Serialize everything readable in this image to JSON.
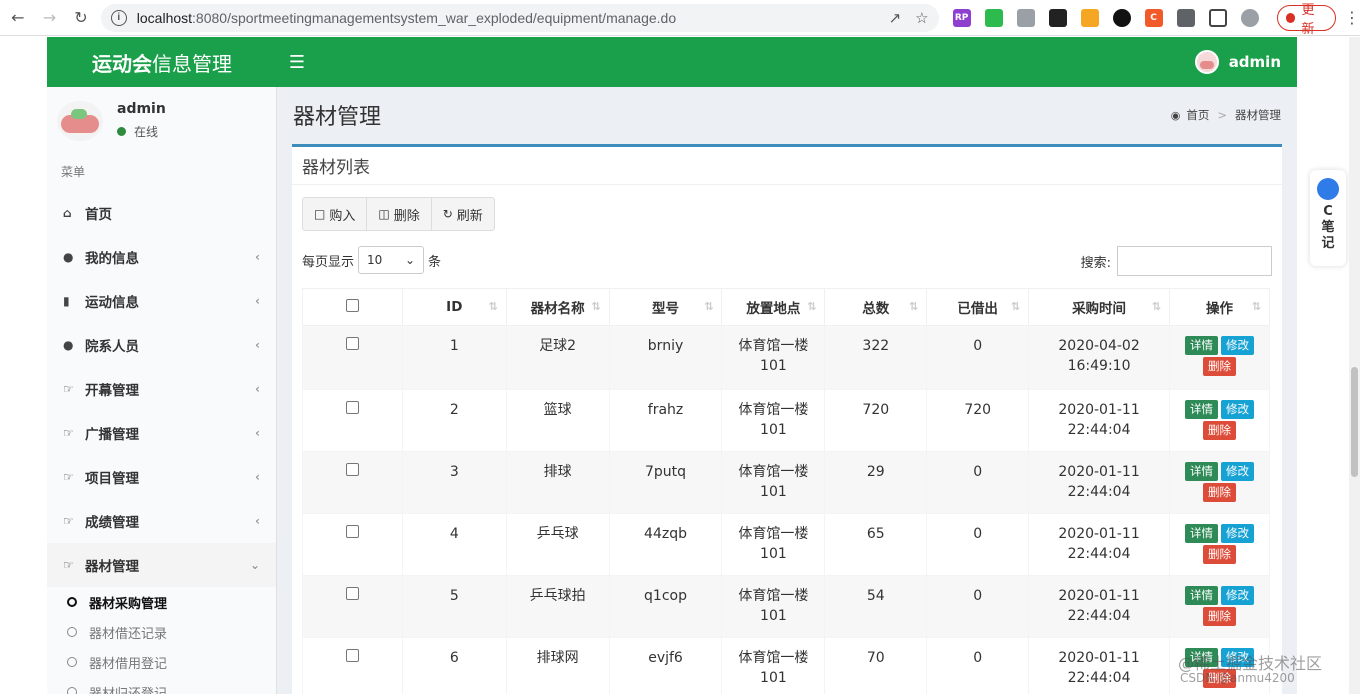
{
  "browser": {
    "url_host": "localhost",
    "url_rest": ":8080/sportmeetingmanagementsystem_war_exploded/equipment/manage.do",
    "update_label": "更新"
  },
  "header": {
    "logo_bold": "运动会",
    "logo_rest": "信息管理",
    "username": "admin",
    "accent_color": "#1a9f4a"
  },
  "sidebar": {
    "user_name": "admin",
    "user_status": "在线",
    "menu_header": "菜单",
    "items": [
      {
        "label": "首页",
        "icon": "home-icon"
      },
      {
        "label": "我的信息",
        "icon": "user-icon"
      },
      {
        "label": "运动信息",
        "icon": "bar-chart-icon"
      },
      {
        "label": "院系人员",
        "icon": "users-icon"
      },
      {
        "label": "开幕管理",
        "icon": "hand-point-icon"
      },
      {
        "label": "广播管理",
        "icon": "hand-point-icon"
      },
      {
        "label": "项目管理",
        "icon": "hand-point-icon"
      },
      {
        "label": "成绩管理",
        "icon": "hand-point-icon"
      },
      {
        "label": "器材管理",
        "icon": "hand-point-icon"
      }
    ],
    "subitems": [
      {
        "label": "器材采购管理",
        "active": true
      },
      {
        "label": "器材借还记录",
        "active": false
      },
      {
        "label": "器材借用登记",
        "active": false
      },
      {
        "label": "器材归还登记",
        "active": false
      }
    ]
  },
  "content": {
    "page_title": "器材管理",
    "breadcrumb_home": "首页",
    "breadcrumb_current": "器材管理",
    "box_title": "器材列表",
    "toolbar": {
      "buy": "购入",
      "delete": "删除",
      "refresh": "刷新"
    },
    "page_length_prefix": "每页显示",
    "page_length_value": "10",
    "page_length_suffix": "条",
    "search_label": "搜索:",
    "search_value": ""
  },
  "table": {
    "columns": [
      "ID",
      "器材名称",
      "型号",
      "放置地点",
      "总数",
      "已借出",
      "采购时间",
      "操作"
    ],
    "actions": {
      "detail": "详情",
      "edit": "修改",
      "delete": "删除"
    },
    "rows": [
      {
        "id": "1",
        "name": "足球2",
        "model": "brniy",
        "loc1": "体育馆一楼",
        "loc2": "101",
        "total": "322",
        "lent": "0",
        "date": "2020-04-02",
        "time": "16:49:10"
      },
      {
        "id": "2",
        "name": "篮球",
        "model": "frahz",
        "loc1": "体育馆一楼",
        "loc2": "101",
        "total": "720",
        "lent": "720",
        "date": "2020-01-11",
        "time": "22:44:04"
      },
      {
        "id": "3",
        "name": "排球",
        "model": "7putq",
        "loc1": "体育馆一楼",
        "loc2": "101",
        "total": "29",
        "lent": "0",
        "date": "2020-01-11",
        "time": "22:44:04"
      },
      {
        "id": "4",
        "name": "乒乓球",
        "model": "44zqb",
        "loc1": "体育馆一楼",
        "loc2": "101",
        "total": "65",
        "lent": "0",
        "date": "2020-01-11",
        "time": "22:44:04"
      },
      {
        "id": "5",
        "name": "乒乓球拍",
        "model": "q1cop",
        "loc1": "体育馆一楼",
        "loc2": "101",
        "total": "54",
        "lent": "0",
        "date": "2020-01-11",
        "time": "22:44:04"
      },
      {
        "id": "6",
        "name": "排球网",
        "model": "evjf6",
        "loc1": "体育馆一楼",
        "loc2": "101",
        "total": "70",
        "lent": "0",
        "date": "2020-01-11",
        "time": "22:44:04"
      }
    ]
  },
  "float_widget": {
    "line1": "C",
    "line2": "笔",
    "line3": "记"
  },
  "watermark": {
    "line1": "@稀土掘金技术社区",
    "line2": "CSDN @anmu4200"
  }
}
